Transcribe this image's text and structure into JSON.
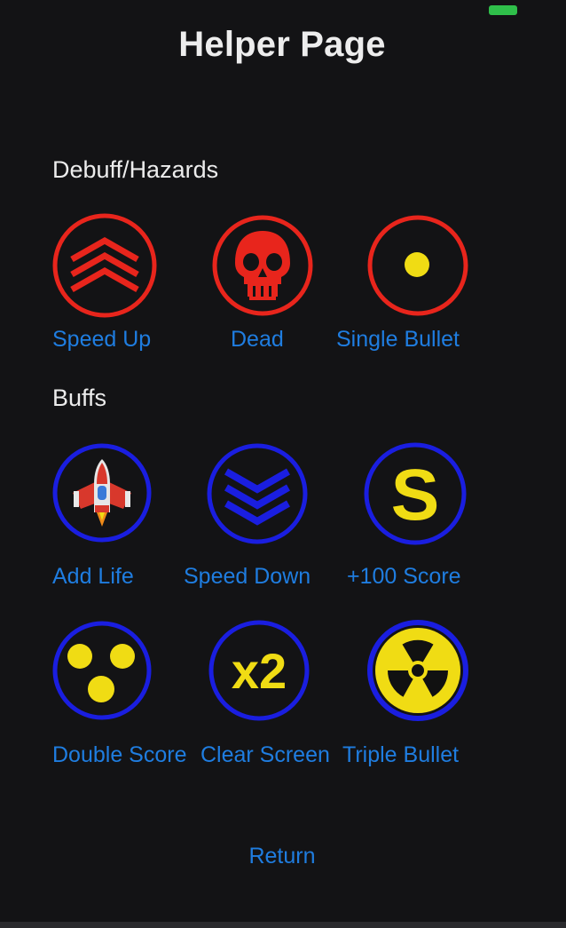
{
  "header": {
    "title": "Helper Page"
  },
  "sections": {
    "debuffs": {
      "heading": "Debuff/Hazards",
      "items": [
        {
          "label": "Speed Up",
          "icon": "speed-up-chevrons-icon"
        },
        {
          "label": "Dead",
          "icon": "skull-icon"
        },
        {
          "label": "Single Bullet",
          "icon": "single-dot-icon"
        }
      ]
    },
    "buffs": {
      "heading": "Buffs",
      "items": [
        {
          "label": "Add Life",
          "icon": "spaceship-icon"
        },
        {
          "label": "Speed Down",
          "icon": "speed-down-chevrons-icon"
        },
        {
          "label": "+100 Score",
          "icon": "letter-s-icon"
        },
        {
          "label": "Double Score",
          "icon": "three-dots-icon"
        },
        {
          "label": "Clear Screen",
          "icon": "x2-icon",
          "text": "x2"
        },
        {
          "label": "Triple Bullet",
          "icon": "radiation-icon"
        }
      ]
    }
  },
  "footer": {
    "return_label": "Return"
  },
  "colors": {
    "background": "#131315",
    "hazard_red": "#e8251c",
    "buff_blue": "#1a1ee0",
    "label_blue": "#1f7de0",
    "icon_yellow": "#f0dc14",
    "status_green": "#2fbf4a"
  }
}
